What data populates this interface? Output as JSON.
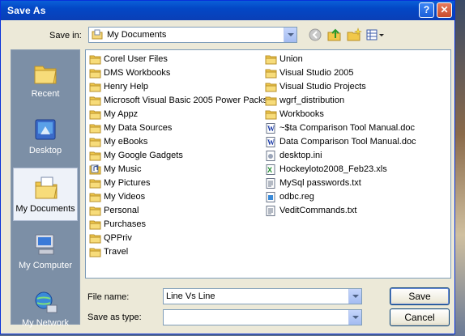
{
  "window": {
    "title": "Save As",
    "help_glyph": "?",
    "close_glyph": "✕"
  },
  "toolbar": {
    "save_in_label": "Save in:",
    "location": "My Documents",
    "icons": [
      "back-icon",
      "up-folder-icon",
      "new-folder-icon",
      "views-menu-icon"
    ]
  },
  "places": [
    {
      "label": "Recent",
      "icon": "recent-icon"
    },
    {
      "label": "Desktop",
      "icon": "desktop-icon"
    },
    {
      "label": "My Documents",
      "icon": "my-documents-icon",
      "selected": true
    },
    {
      "label": "My Computer",
      "icon": "my-computer-icon"
    },
    {
      "label": "My Network",
      "icon": "my-network-icon"
    }
  ],
  "files": {
    "col1": [
      {
        "name": "Corel User Files",
        "type": "folder"
      },
      {
        "name": "DMS Workbooks",
        "type": "folder"
      },
      {
        "name": "Henry Help",
        "type": "folder"
      },
      {
        "name": "Microsoft Visual Basic 2005 Power Packs",
        "type": "folder"
      },
      {
        "name": "My Appz",
        "type": "folder"
      },
      {
        "name": "My Data Sources",
        "type": "folder"
      },
      {
        "name": "My eBooks",
        "type": "folder"
      },
      {
        "name": "My Google Gadgets",
        "type": "folder"
      },
      {
        "name": "My Music",
        "type": "music-folder"
      },
      {
        "name": "My Pictures",
        "type": "folder"
      },
      {
        "name": "My Videos",
        "type": "folder"
      },
      {
        "name": "Personal",
        "type": "folder"
      },
      {
        "name": "Purchases",
        "type": "folder"
      },
      {
        "name": "QPPriv",
        "type": "folder"
      },
      {
        "name": "Travel",
        "type": "folder"
      }
    ],
    "col2": [
      {
        "name": "Union",
        "type": "folder"
      },
      {
        "name": "Visual Studio 2005",
        "type": "folder"
      },
      {
        "name": "Visual Studio Projects",
        "type": "folder"
      },
      {
        "name": "wgrf_distribution",
        "type": "folder"
      },
      {
        "name": "Workbooks",
        "type": "folder"
      },
      {
        "name": "~$ta Comparison Tool Manual.doc",
        "type": "word"
      },
      {
        "name": "Data Comparison Tool Manual.doc",
        "type": "word"
      },
      {
        "name": "desktop.ini",
        "type": "ini"
      },
      {
        "name": "Hockeyloto2008_Feb23.xls",
        "type": "excel"
      },
      {
        "name": "MySql passwords.txt",
        "type": "text"
      },
      {
        "name": "odbc.reg",
        "type": "reg"
      },
      {
        "name": "VeditCommands.txt",
        "type": "text"
      }
    ]
  },
  "form": {
    "file_name_label": "File name:",
    "file_name_value": "Line Vs Line",
    "save_as_type_label": "Save as type:",
    "save_as_type_value": ""
  },
  "buttons": {
    "save": "Save",
    "cancel": "Cancel"
  }
}
